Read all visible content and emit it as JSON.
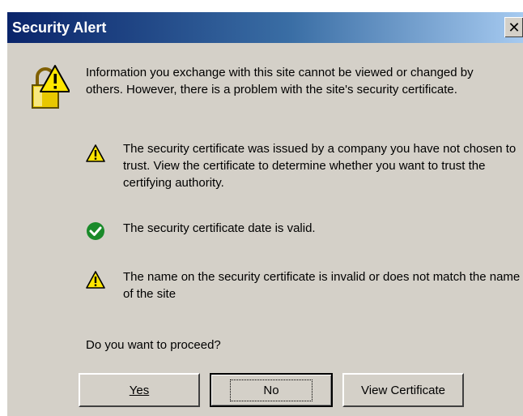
{
  "window": {
    "title": "Security Alert",
    "close_glyph": "✕"
  },
  "intro_text": "Information you exchange with this site cannot be viewed or changed by others. However, there is a problem with the site's security certificate.",
  "items": [
    {
      "icon": "warning-icon",
      "text": "The security certificate was issued by a company you have not chosen to trust. View the certificate to determine whether you want to trust the certifying authority."
    },
    {
      "icon": "check-icon",
      "text": "The security certificate date is valid."
    },
    {
      "icon": "warning-icon",
      "text": "The name on the security certificate is invalid or does not match the name of the site"
    }
  ],
  "question": "Do you want to proceed?",
  "buttons": {
    "yes": "Yes",
    "no": "No",
    "view_certificate": "View Certificate"
  },
  "colors": {
    "dialog_bg": "#d4d0c8",
    "title_start": "#0a246a",
    "title_end": "#a6caf0",
    "warning": "#ffe600",
    "ok": "#1a8a2a"
  }
}
